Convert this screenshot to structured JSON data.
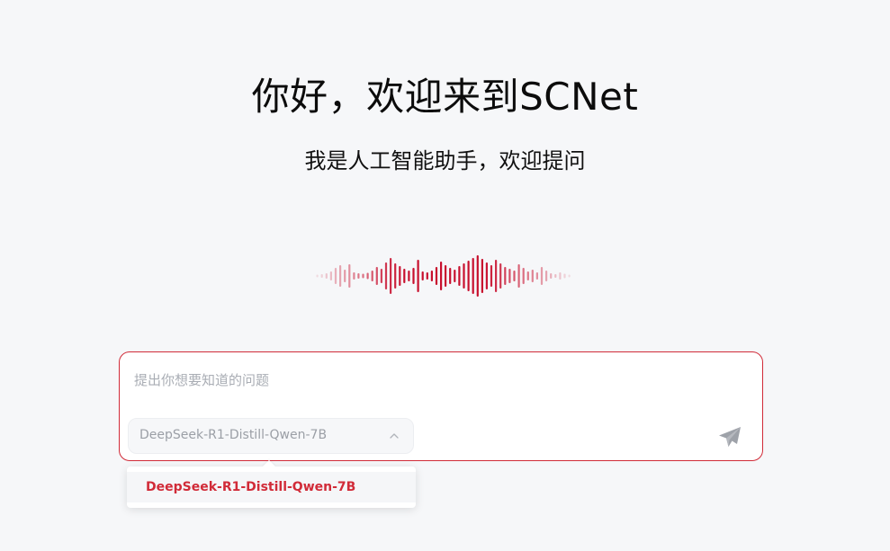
{
  "hero": {
    "title": "你好，欢迎来到SCNet",
    "subtitle": "我是人工智能助手，欢迎提问"
  },
  "waveform": {
    "icon": "audio-wave-icon",
    "color": "#c8102e"
  },
  "chat": {
    "placeholder": "提出你想要知道的问题",
    "input_value": "",
    "model_select": {
      "selected": "DeepSeek-R1-Distill-Qwen-7B",
      "expanded": true,
      "icon": "chevron-up-icon"
    },
    "send_icon": "send-icon"
  },
  "dropdown": {
    "options": [
      {
        "label": "DeepSeek-R1-Distill-Qwen-7B",
        "selected": true
      }
    ]
  },
  "colors": {
    "accent": "#d12b38",
    "background": "#f6f7f9",
    "placeholder": "#a9adb4"
  }
}
